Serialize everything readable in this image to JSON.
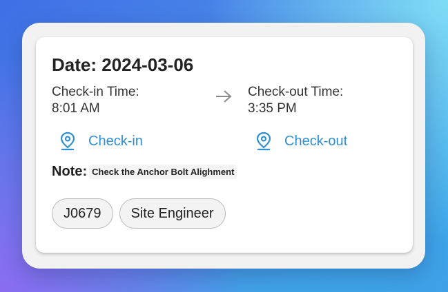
{
  "attendance": {
    "date_label": "Date: 2024-03-06",
    "checkin_time_label": "Check-in Time:",
    "checkin_time_value": "8:01 AM",
    "checkout_time_label": "Check-out Time:",
    "checkout_time_value": "3:35 PM",
    "checkin_link": "Check-in",
    "checkout_link": "Check-out",
    "note_label": "Note:",
    "note_text": "Check the Anchor Bolt Alighment",
    "chips": [
      "J0679",
      "Site Engineer"
    ]
  },
  "icons": {
    "arrow": "arrow-right-icon",
    "location": "location-pin-icon"
  },
  "colors": {
    "accent": "#2f8fce",
    "text": "#222222"
  }
}
